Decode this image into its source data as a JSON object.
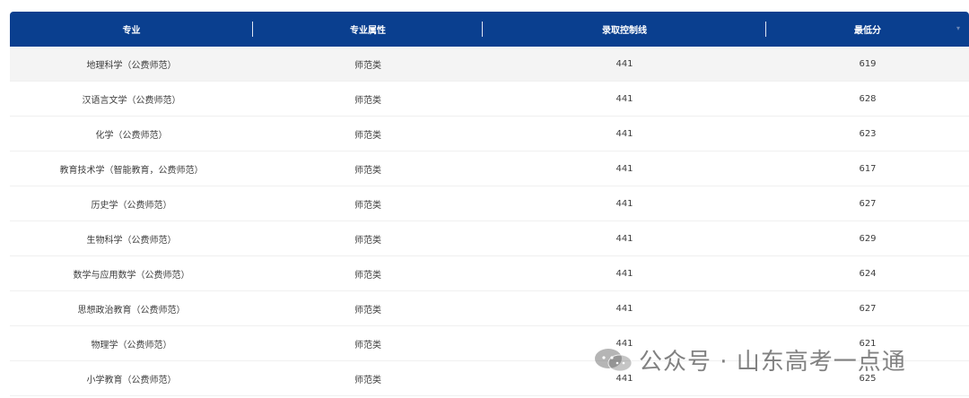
{
  "table": {
    "headers": [
      "专业",
      "专业属性",
      "录取控制线",
      "最低分"
    ],
    "rows": [
      {
        "major": "地理科学（公费师范）",
        "attr": "师范类",
        "control_line": "441",
        "min_score": "619"
      },
      {
        "major": "汉语言文学（公费师范）",
        "attr": "师范类",
        "control_line": "441",
        "min_score": "628"
      },
      {
        "major": "化学（公费师范）",
        "attr": "师范类",
        "control_line": "441",
        "min_score": "623"
      },
      {
        "major": "教育技术学（智能教育，公费师范）",
        "attr": "师范类",
        "control_line": "441",
        "min_score": "617"
      },
      {
        "major": "历史学（公费师范）",
        "attr": "师范类",
        "control_line": "441",
        "min_score": "627"
      },
      {
        "major": "生物科学（公费师范）",
        "attr": "师范类",
        "control_line": "441",
        "min_score": "629"
      },
      {
        "major": "数学与应用数学（公费师范）",
        "attr": "师范类",
        "control_line": "441",
        "min_score": "624"
      },
      {
        "major": "思想政治教育（公费师范）",
        "attr": "师范类",
        "control_line": "441",
        "min_score": "627"
      },
      {
        "major": "物理学（公费师范）",
        "attr": "师范类",
        "control_line": "441",
        "min_score": "621"
      },
      {
        "major": "小学教育（公费师范）",
        "attr": "师范类",
        "control_line": "441",
        "min_score": "625"
      }
    ]
  },
  "watermark": {
    "text": "公众号 · 山东高考一点通"
  },
  "colors": {
    "header_bg": "#0a3f8f",
    "header_text": "#ffffff",
    "row_text": "#3d3d3d",
    "first_row_bg": "#f4f4f4"
  }
}
